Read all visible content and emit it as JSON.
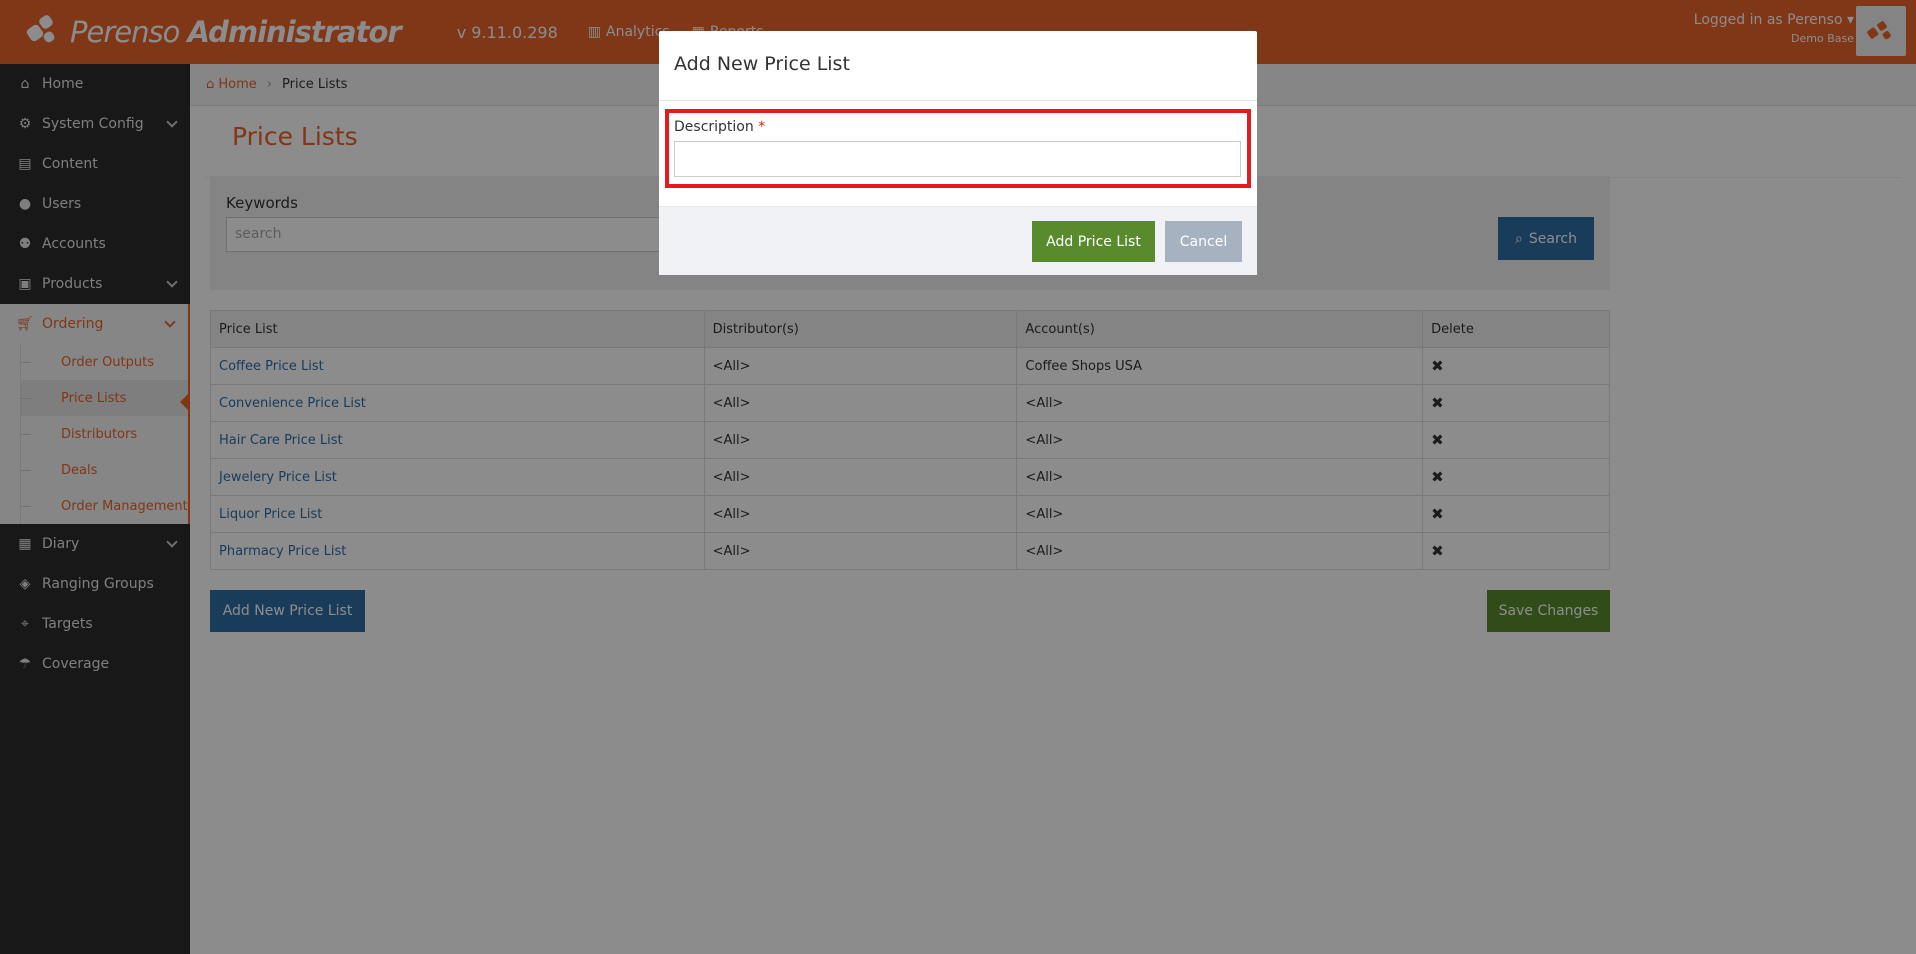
{
  "app": {
    "logo_text_1": "Perenso",
    "logo_text_2": "Administrator",
    "version": "v 9.11.0.298",
    "nav": [
      "Analytics",
      "Reports"
    ],
    "user_line": "Logged in as Perenso",
    "user_base": "Demo Base"
  },
  "sidebar": {
    "items": [
      {
        "label": "Home",
        "icon": "home-icon"
      },
      {
        "label": "System Config",
        "icon": "gear-icon"
      },
      {
        "label": "Content",
        "icon": "file-icon"
      },
      {
        "label": "Users",
        "icon": "user-icon"
      },
      {
        "label": "Accounts",
        "icon": "users-icon"
      },
      {
        "label": "Products",
        "icon": "gift-icon"
      },
      {
        "label": "Ordering",
        "icon": "cart-icon"
      }
    ],
    "ordering_sub": [
      "Order Outputs",
      "Price Lists",
      "Distributors",
      "Deals",
      "Order Management"
    ],
    "items_after": [
      {
        "label": "Diary",
        "icon": "calendar-icon"
      },
      {
        "label": "Ranging Groups",
        "icon": "cubes-icon"
      },
      {
        "label": "Targets",
        "icon": "crosshairs-icon"
      },
      {
        "label": "Coverage",
        "icon": "umbrella-icon"
      }
    ]
  },
  "breadcrumb": {
    "home": "Home",
    "current": "Price Lists"
  },
  "page_title": "Price Lists",
  "search": {
    "label": "Keywords",
    "placeholder": "search",
    "button": "Search"
  },
  "table": {
    "headers": [
      "Price List",
      "Distributor(s)",
      "Account(s)",
      "Delete"
    ],
    "rows": [
      [
        "Coffee Price List",
        "<All>",
        "Coffee Shops USA"
      ],
      [
        "Convenience Price List",
        "<All>",
        "<All>"
      ],
      [
        "Hair Care Price List",
        "<All>",
        "<All>"
      ],
      [
        "Jewelery Price List",
        "<All>",
        "<All>"
      ],
      [
        "Liquor Price List",
        "<All>",
        "<All>"
      ],
      [
        "Pharmacy Price List",
        "<All>",
        "<All>"
      ]
    ],
    "delete_glyph": "✖"
  },
  "buttons": {
    "add_new": "Add New Price List",
    "save": "Save Changes"
  },
  "modal": {
    "title": "Add New Price List",
    "field_label": "Description",
    "required_mark": "*",
    "field_value": "",
    "add_button": "Add Price List",
    "cancel_button": "Cancel"
  },
  "colors": {
    "brand": "#e8642a",
    "primary": "#2f6ea5",
    "success": "#5a8a2e",
    "highlight": "#e11b22"
  }
}
